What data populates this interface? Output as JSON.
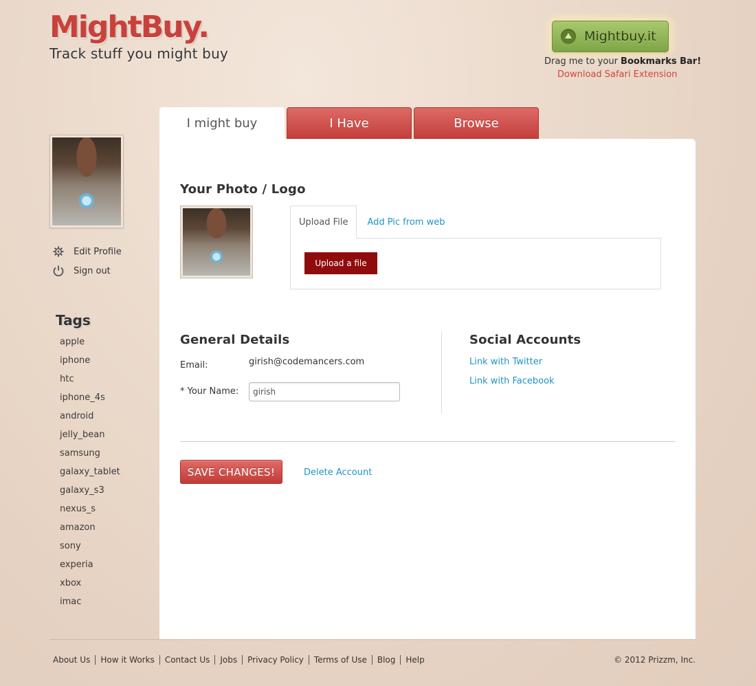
{
  "header": {
    "logo": "MightBuy.",
    "tagline": "Track stuff you might buy",
    "bookmarklet_label": "Mightbuy.it",
    "drag_text_prefix": "Drag me to your ",
    "drag_text_bold": "Bookmarks Bar!",
    "safari_link": "Download Safari Extension"
  },
  "sidebar": {
    "menu": [
      {
        "label": "Edit Profile",
        "icon": "gear-icon"
      },
      {
        "label": "Sign out",
        "icon": "power-icon"
      }
    ],
    "tags_title": "Tags",
    "tags": [
      "apple",
      "iphone",
      "htc",
      "iphone_4s",
      "android",
      "jelly_bean",
      "samsung",
      "galaxy_tablet",
      "galaxy_s3",
      "nexus_s",
      "amazon",
      "sony",
      "experia",
      "xbox",
      "imac"
    ]
  },
  "tabs": [
    {
      "label": "I might buy",
      "active": true
    },
    {
      "label": "I Have",
      "active": false
    },
    {
      "label": "Browse",
      "active": false
    }
  ],
  "photo_section": {
    "title": "Your Photo / Logo",
    "upload_tab": "Upload File",
    "web_tab": "Add Pic from web",
    "upload_button": "Upload a file"
  },
  "general": {
    "title": "General Details",
    "email_label": "Email:",
    "email_value": "girish@codemancers.com",
    "name_label": "* Your Name:",
    "name_value": "girish"
  },
  "social": {
    "title": "Social Accounts",
    "twitter": "Link with Twitter",
    "facebook": "Link with Facebook"
  },
  "actions": {
    "save": "SAVE CHANGES!",
    "delete": "Delete Account"
  },
  "footer": {
    "links": [
      "About Us",
      "How it Works",
      "Contact Us",
      "Jobs",
      "Privacy Policy",
      "Terms of Use",
      "Blog",
      "Help"
    ],
    "copyright": "© 2012 Prizzm, Inc."
  },
  "colors": {
    "brand_red": "#c9413c",
    "link_blue": "#1e94c6",
    "upload_button": "#8f0c0c",
    "bookmarklet_green": "#8fb552"
  }
}
